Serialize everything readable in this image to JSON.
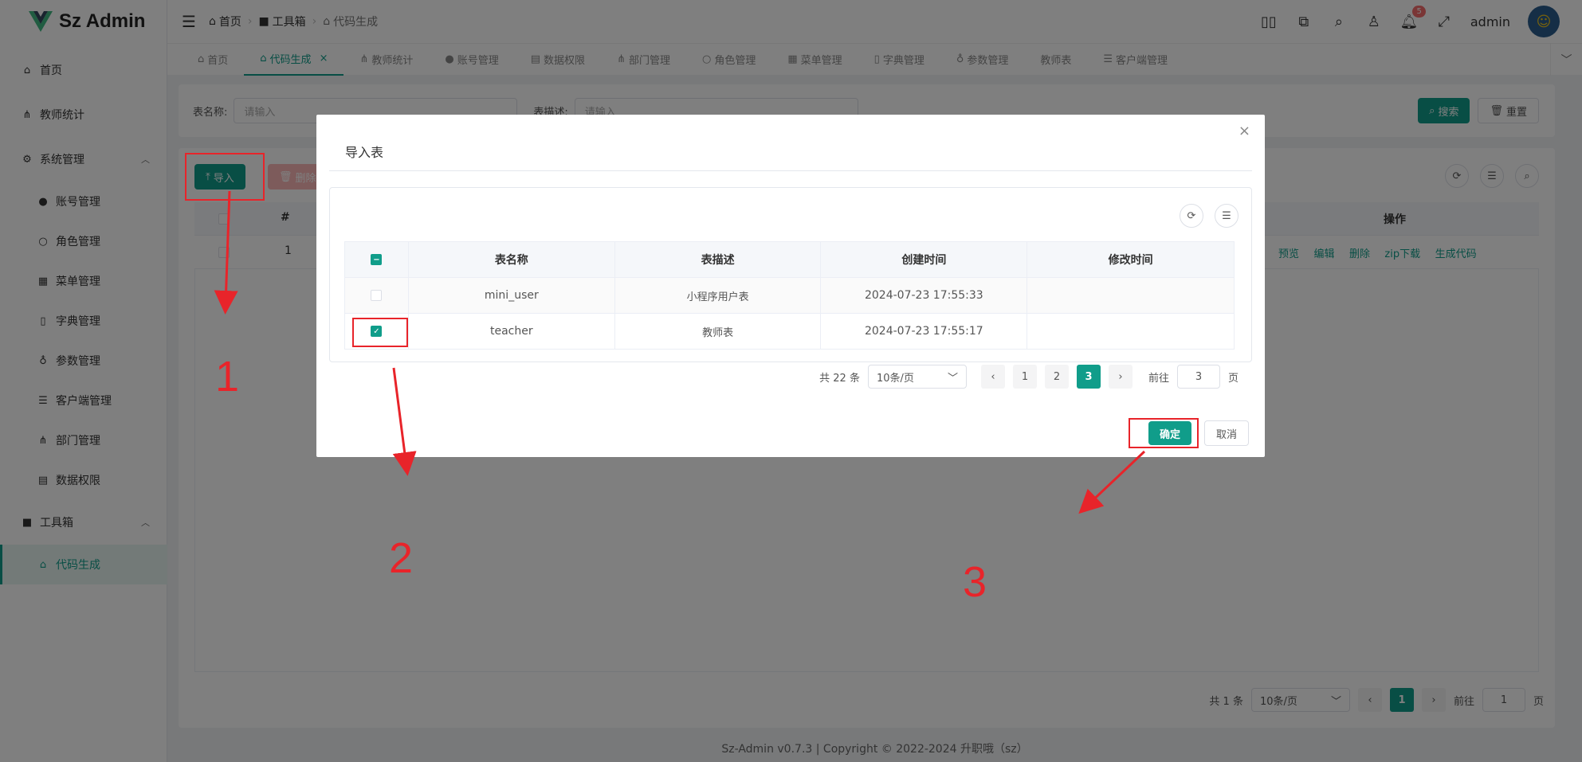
{
  "app": {
    "name": "Sz Admin"
  },
  "sidebar": {
    "items": [
      {
        "label": "首页",
        "icon": "home-icon"
      },
      {
        "label": "教师统计",
        "icon": "org-icon"
      },
      {
        "label": "系统管理",
        "icon": "gear-icon"
      },
      {
        "label": "账号管理",
        "icon": "user-icon"
      },
      {
        "label": "角色管理",
        "icon": "role-icon"
      },
      {
        "label": "菜单管理",
        "icon": "grid-icon"
      },
      {
        "label": "字典管理",
        "icon": "book-icon"
      },
      {
        "label": "参数管理",
        "icon": "param-icon"
      },
      {
        "label": "客户端管理",
        "icon": "sliders-icon"
      },
      {
        "label": "部门管理",
        "icon": "org-icon"
      },
      {
        "label": "数据权限",
        "icon": "data-icon"
      },
      {
        "label": "工具箱",
        "icon": "toolbox-icon"
      },
      {
        "label": "代码生成",
        "icon": "code-icon"
      }
    ]
  },
  "header": {
    "breadcrumb": [
      "首页",
      "工具箱",
      "代码生成"
    ],
    "user": "admin",
    "notification_count": "5"
  },
  "tabs": [
    "首页",
    "代码生成",
    "教师统计",
    "账号管理",
    "数据权限",
    "部门管理",
    "角色管理",
    "菜单管理",
    "字典管理",
    "参数管理",
    "教师表",
    "客户端管理"
  ],
  "search": {
    "table_name_label": "表名称:",
    "table_name_placeholder": "请输入",
    "table_desc_label": "表描述:",
    "table_desc_placeholder": "请输入",
    "search_btn": "搜索",
    "reset_btn": "重置"
  },
  "toolbar": {
    "import_btn": "导入",
    "delete_btn": "删除"
  },
  "bg_table": {
    "col_index": "#",
    "col_ops": "操作",
    "row_index": "1",
    "ops": [
      "预览",
      "编辑",
      "删除",
      "zip下载",
      "生成代码"
    ]
  },
  "bg_pager": {
    "total": "共 1 条",
    "page_size": "10条/页",
    "page": "1",
    "goto": "前往",
    "goto_value": "1",
    "goto_unit": "页"
  },
  "footer": "Sz-Admin v0.7.3 | Copyright © 2022-2024 升职哦（sz）",
  "dialog": {
    "title": "导入表",
    "columns": [
      "表名称",
      "表描述",
      "创建时间",
      "修改时间"
    ],
    "rows": [
      {
        "name": "mini_user",
        "desc": "小程序用户表",
        "created": "2024-07-23 17:55:33",
        "modified": "",
        "checked": false
      },
      {
        "name": "teacher",
        "desc": "教师表",
        "created": "2024-07-23 17:55:17",
        "modified": "",
        "checked": true
      }
    ],
    "pager": {
      "total": "共 22 条",
      "page_size": "10条/页",
      "pages": [
        "1",
        "2",
        "3"
      ],
      "current": "3",
      "goto": "前往",
      "goto_value": "3",
      "goto_unit": "页"
    },
    "confirm_btn": "确定",
    "cancel_btn": "取消"
  },
  "annotations": [
    "1",
    "2",
    "3"
  ],
  "colors": {
    "primary": "#109d8a",
    "annotation": "#e8242a"
  }
}
